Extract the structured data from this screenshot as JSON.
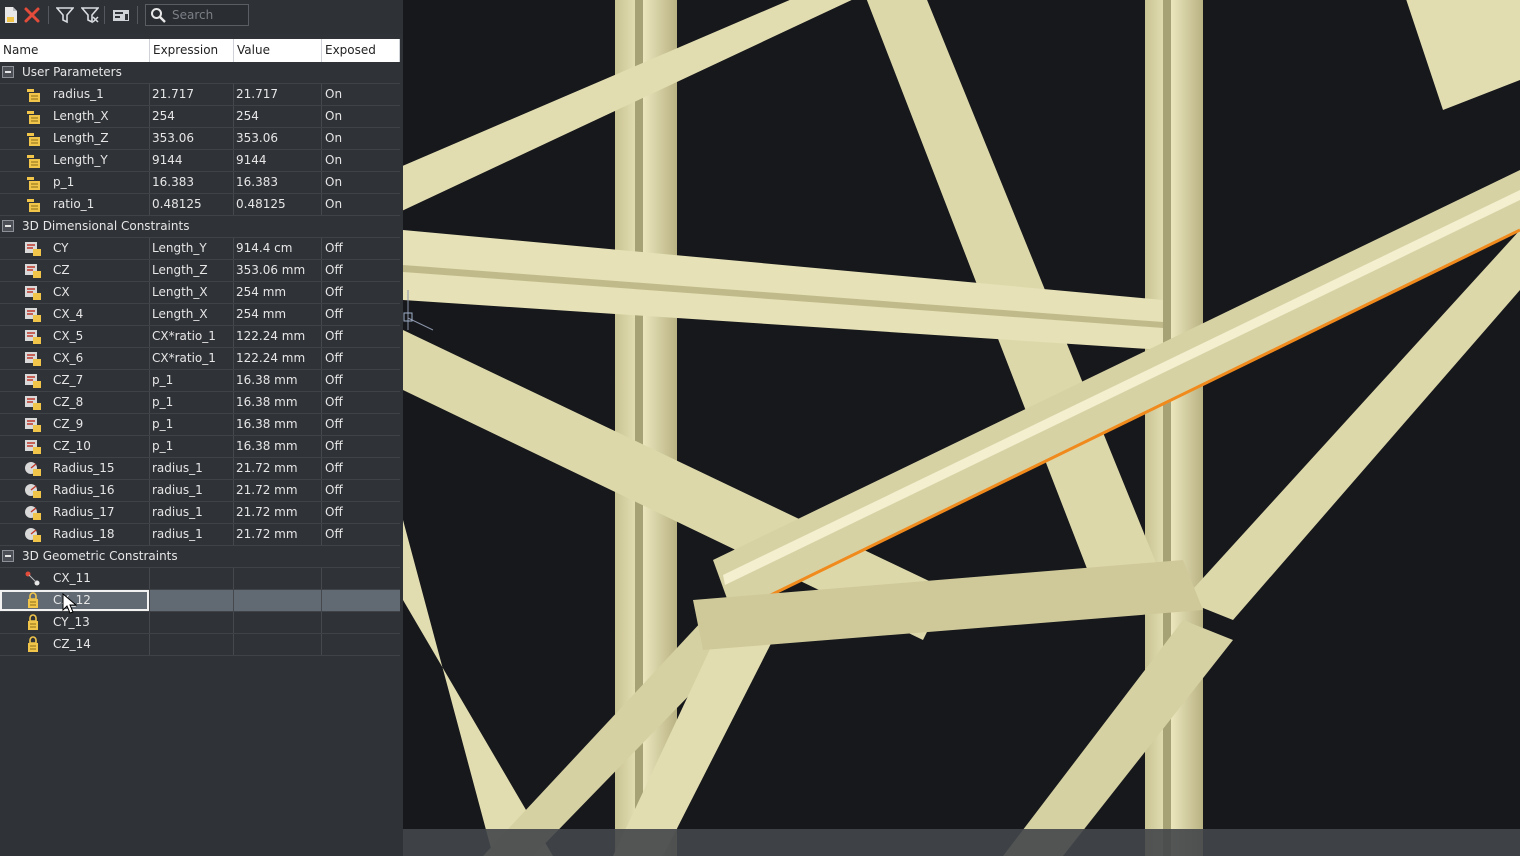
{
  "toolbar": {
    "search_placeholder": "Search",
    "icons": [
      "new-parameter-icon",
      "delete-icon",
      "filter-icon",
      "clear-filter-icon",
      "manage-icon"
    ],
    "colors": {
      "delete": "#e34b3a",
      "icon": "#d9dde2"
    }
  },
  "columns": [
    "Name",
    "Expression",
    "Value",
    "Exposed"
  ],
  "groups": [
    {
      "label": "User Parameters",
      "icon": "user-parameter-icon",
      "rows": [
        {
          "name": "radius_1",
          "expression": "21.717",
          "value": "21.717",
          "exposed": "On"
        },
        {
          "name": "Length_X",
          "expression": "254",
          "value": "254",
          "exposed": "On"
        },
        {
          "name": "Length_Z",
          "expression": "353.06",
          "value": "353.06",
          "exposed": "On"
        },
        {
          "name": "Length_Y",
          "expression": "9144",
          "value": "9144",
          "exposed": "On"
        },
        {
          "name": "p_1",
          "expression": "16.383",
          "value": "16.383",
          "exposed": "On"
        },
        {
          "name": "ratio_1",
          "expression": "0.48125",
          "value": "0.48125",
          "exposed": "On"
        }
      ]
    },
    {
      "label": "3D Dimensional Constraints",
      "icon": "dimensional-constraint-icon",
      "rows": [
        {
          "name": "CY",
          "expression": "Length_Y",
          "value": "914.4 cm",
          "exposed": "Off"
        },
        {
          "name": "CZ",
          "expression": "Length_Z",
          "value": "353.06 mm",
          "exposed": "Off"
        },
        {
          "name": "CX",
          "expression": "Length_X",
          "value": "254 mm",
          "exposed": "Off"
        },
        {
          "name": "CX_4",
          "expression": "Length_X",
          "value": "254 mm",
          "exposed": "Off"
        },
        {
          "name": "CX_5",
          "expression": "CX*ratio_1",
          "value": "122.24 mm",
          "exposed": "Off"
        },
        {
          "name": "CX_6",
          "expression": "CX*ratio_1",
          "value": "122.24 mm",
          "exposed": "Off"
        },
        {
          "name": "CZ_7",
          "expression": "p_1",
          "value": "16.38 mm",
          "exposed": "Off"
        },
        {
          "name": "CZ_8",
          "expression": "p_1",
          "value": "16.38 mm",
          "exposed": "Off"
        },
        {
          "name": "CZ_9",
          "expression": "p_1",
          "value": "16.38 mm",
          "exposed": "Off"
        },
        {
          "name": "CZ_10",
          "expression": "p_1",
          "value": "16.38 mm",
          "exposed": "Off"
        },
        {
          "name": "Radius_15",
          "expression": "radius_1",
          "value": "21.72 mm",
          "exposed": "Off",
          "radius": true
        },
        {
          "name": "Radius_16",
          "expression": "radius_1",
          "value": "21.72 mm",
          "exposed": "Off",
          "radius": true
        },
        {
          "name": "Radius_17",
          "expression": "radius_1",
          "value": "21.72 mm",
          "exposed": "Off",
          "radius": true
        },
        {
          "name": "Radius_18",
          "expression": "radius_1",
          "value": "21.72 mm",
          "exposed": "Off",
          "radius": true
        }
      ]
    },
    {
      "label": "3D Geometric Constraints",
      "icon": "geometric-constraint-icon",
      "rows": [
        {
          "name": "CX_11",
          "expression": "",
          "value": "",
          "exposed": "",
          "coincident": true
        },
        {
          "name": "CX_12",
          "expression": "",
          "value": "",
          "exposed": "",
          "selected": true
        },
        {
          "name": "CY_13",
          "expression": "",
          "value": "",
          "exposed": ""
        },
        {
          "name": "CZ_14",
          "expression": "",
          "value": "",
          "exposed": ""
        }
      ]
    }
  ],
  "viewport": {
    "background": "#17181c",
    "beam_color": "#e6e1b4",
    "highlight_edge_color": "#f08a1c"
  }
}
